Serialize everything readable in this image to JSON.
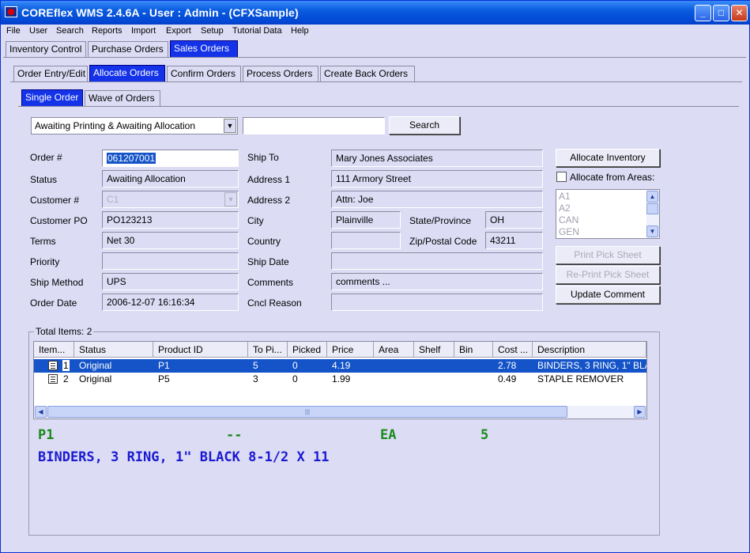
{
  "window": {
    "title": "COREflex WMS 2.4.6A - User : Admin - (CFXSample)"
  },
  "menu": [
    "File",
    "User",
    "Search",
    "Reports",
    "Import",
    "Export",
    "Setup",
    "Tutorial Data",
    "Help"
  ],
  "main_tabs": [
    "Inventory Control",
    "Purchase Orders",
    "Sales Orders"
  ],
  "sub_tabs": [
    "Order Entry/Edit",
    "Allocate Orders",
    "Confirm Orders",
    "Process Orders",
    "Create Back Orders"
  ],
  "mode_tabs": [
    "Single Order",
    "Wave of Orders"
  ],
  "filter": {
    "status_option": "Awaiting Printing & Awaiting Allocation",
    "search_value": "",
    "search_label": "Search"
  },
  "form": {
    "order_no_label": "Order #",
    "order_no": "061207001",
    "status_label": "Status",
    "status": "Awaiting Allocation",
    "customer_label": "Customer #",
    "customer": "C1",
    "customer_po_label": "Customer PO",
    "customer_po": "PO123213",
    "terms_label": "Terms",
    "terms": "Net 30",
    "priority_label": "Priority",
    "priority": "",
    "ship_method_label": "Ship Method",
    "ship_method": "UPS",
    "order_date_label": "Order Date",
    "order_date": "2006-12-07 16:16:34",
    "ship_to_label": "Ship To",
    "ship_to": "Mary Jones Associates",
    "address1_label": "Address 1",
    "address1": "111 Armory Street",
    "address2_label": "Address 2",
    "address2": "Attn: Joe",
    "city_label": "City",
    "city": "Plainville",
    "state_label": "State/Province",
    "state": "OH",
    "country_label": "Country",
    "country": "",
    "zip_label": "Zip/Postal Code",
    "zip": "43211",
    "ship_date_label": "Ship Date",
    "ship_date": "",
    "comments_label": "Comments",
    "comments": "comments ...",
    "cancel_reason_label": "Cncl Reason",
    "cancel_reason": ""
  },
  "actions": {
    "allocate_inventory": "Allocate Inventory",
    "allocate_from_areas": "Allocate from Areas:",
    "areas": [
      "A1",
      "A2",
      "CAN",
      "GEN"
    ],
    "print_pick_sheet": "Print Pick Sheet",
    "reprint_pick_sheet": "Re-Print Pick Sheet",
    "update_comment": "Update Comment"
  },
  "items": {
    "group_label": "Total Items: 2",
    "columns": [
      "Item...",
      "Status",
      "Product ID",
      "To Pi...",
      "Picked",
      "Price",
      "Area",
      "Shelf",
      "Bin",
      "Cost ...",
      "Description"
    ],
    "rows": [
      {
        "item": "1",
        "status": "Original",
        "product": "P1",
        "to_pick": "5",
        "picked": "0",
        "price": "4.19",
        "area": "",
        "shelf": "",
        "bin": "",
        "cost": "2.78",
        "description": "BINDERS, 3 RING, 1\" BLA"
      },
      {
        "item": "2",
        "status": "Original",
        "product": "P5",
        "to_pick": "3",
        "picked": "0",
        "price": "1.99",
        "area": "",
        "shelf": "",
        "bin": "",
        "cost": "0.49",
        "description": "STAPLE REMOVER"
      }
    ]
  },
  "detail": {
    "product": "P1",
    "dashes": "--",
    "uom": "EA",
    "qty": "5",
    "description": "BINDERS, 3 RING, 1\" BLACK 8-1/2 X 11",
    "color_green": "#1a8a1a",
    "color_blue": "#1a1ad0"
  }
}
